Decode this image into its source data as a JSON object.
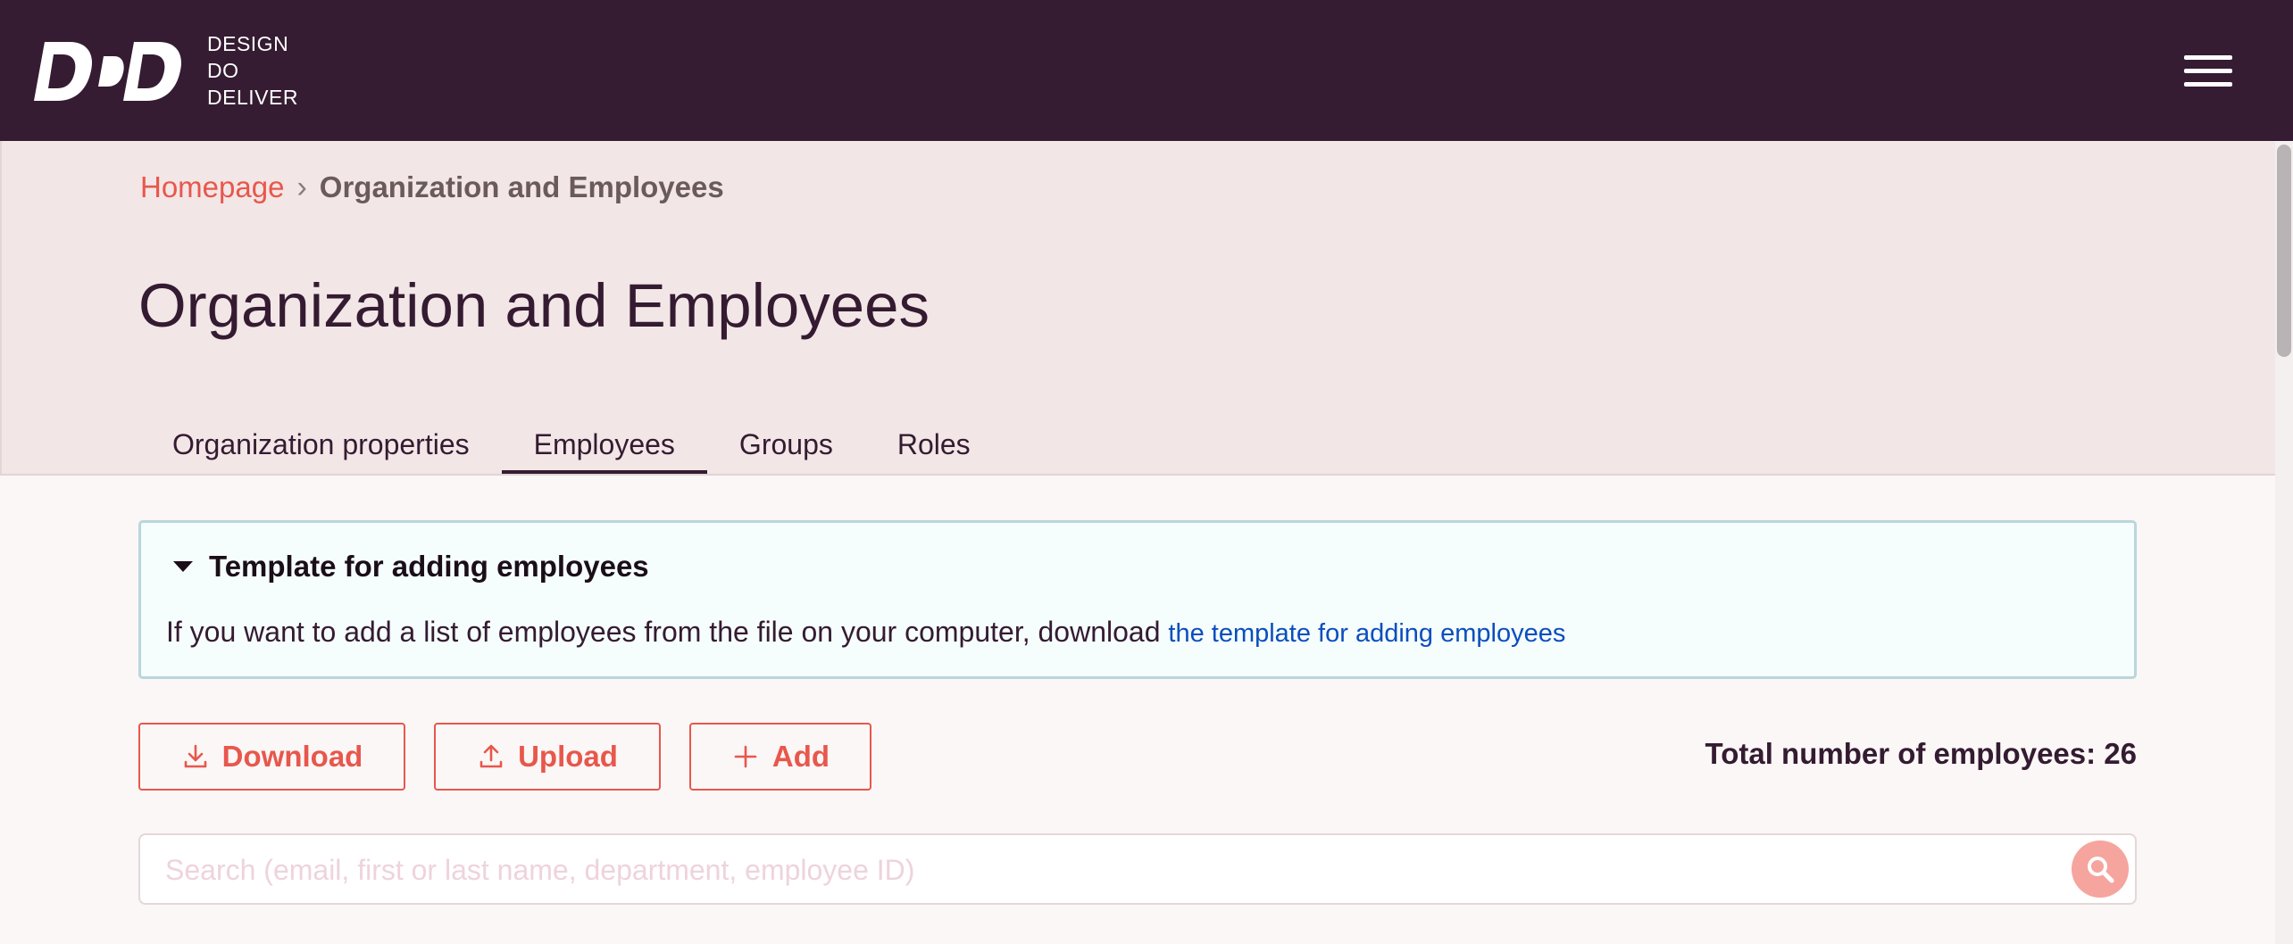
{
  "header": {
    "logo_lines": [
      "DESIGN",
      "DO",
      "DELIVER"
    ],
    "menu_icon": "hamburger-menu-icon"
  },
  "breadcrumb": {
    "home": "Homepage",
    "separator": "›",
    "current": "Organization and Employees"
  },
  "page": {
    "title": "Organization and Employees"
  },
  "tabs": [
    {
      "label": "Organization properties",
      "active": false
    },
    {
      "label": "Employees",
      "active": true
    },
    {
      "label": "Groups",
      "active": false
    },
    {
      "label": "Roles",
      "active": false
    }
  ],
  "notice": {
    "title": "Template for adding employees",
    "text": "If you want to add a list of employees from the file on your computer, download",
    "link": "the template for adding employees"
  },
  "actions": {
    "download_label": "Download",
    "upload_label": "Upload",
    "add_label": "Add",
    "total_text": "Total number of employees: 26"
  },
  "search": {
    "placeholder": "Search (email, first or last name, department, employee ID)"
  },
  "colors": {
    "header_bg": "#351c32",
    "hero_bg": "#f2e6e6",
    "accent": "#e8574c",
    "link": "#0b4ebd",
    "text": "#341b31"
  }
}
